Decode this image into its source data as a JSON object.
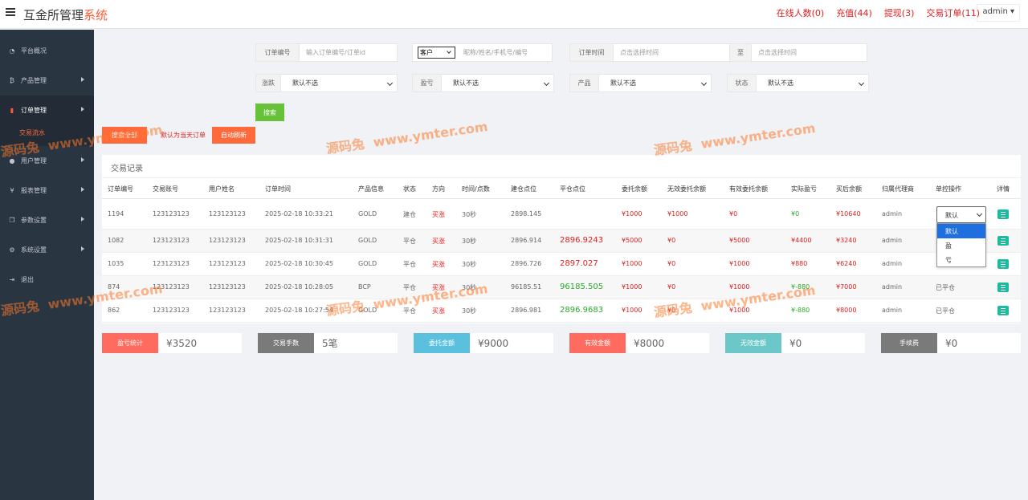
{
  "header": {
    "title_main": "互金所管理",
    "title_accent": "系统",
    "links": [
      "在线人数(0)",
      "充值(44)",
      "提现(3)",
      "交易订单(11)"
    ],
    "admin": "admin"
  },
  "sidebar": {
    "items": [
      {
        "icon": "dashboard-icon",
        "label": "平台概况"
      },
      {
        "icon": "currency-icon",
        "label": "产品管理"
      },
      {
        "icon": "document-icon",
        "label": "订单管理"
      },
      {
        "icon": "user-icon",
        "label": "用户管理"
      },
      {
        "icon": "yen-icon",
        "label": "报表管理"
      },
      {
        "icon": "copy-icon",
        "label": "参数设置"
      },
      {
        "icon": "gears-icon",
        "label": "系统设置"
      },
      {
        "icon": "logout-icon",
        "label": "退出"
      }
    ],
    "sub_item": "交易流水"
  },
  "filters": {
    "order_no_label": "订单编号",
    "order_no_placeholder": "输入订单编号/订单id",
    "customer_select": "客户",
    "customer_placeholder": "昵称/姓名/手机号/编号",
    "time_label": "订单时间",
    "time_start_placeholder": "点击选择时间",
    "to_label": "至",
    "time_end_placeholder": "点击选择时间",
    "updown_label": "涨跌",
    "updown_value": "默认不选",
    "pnl_label": "盈亏",
    "pnl_value": "默认不选",
    "product_label": "产品",
    "product_value": "默认不选",
    "status_label": "状态",
    "status_value": "默认不选",
    "search_button": "搜索",
    "all_button": "搜索全部",
    "default_today": "默认为当天订单",
    "refresh_button": "自动刷新"
  },
  "table": {
    "title": "交易记录",
    "headers": [
      "订单编号",
      "交易账号",
      "用户姓名",
      "订单时间",
      "产品信息",
      "状态",
      "方向",
      "时间/点数",
      "建仓点位",
      "平仓点位",
      "委托余额",
      "无效委托余额",
      "有效委托余额",
      "实际盈亏",
      "买后余额",
      "归属代理商",
      "单控操作",
      "详情"
    ],
    "rows": [
      {
        "id": "1194",
        "account": "123123123",
        "name": "123123123",
        "time": "2025-02-18 10:33:21",
        "product": "GOLD",
        "status": "建仓",
        "direction": "买涨",
        "duration": "30秒",
        "open": "2898.145",
        "close": "",
        "entrust": "¥1000",
        "invalid": "¥1000",
        "valid": "¥0",
        "pnl": "¥0",
        "after": "¥10640",
        "agent": "admin",
        "control": "默认"
      },
      {
        "id": "1082",
        "account": "123123123",
        "name": "123123123",
        "time": "2025-02-18 10:31:31",
        "product": "GOLD",
        "status": "平仓",
        "direction": "买涨",
        "duration": "30秒",
        "open": "2896.914",
        "close": "2896.9243",
        "entrust": "¥5000",
        "invalid": "¥0",
        "valid": "¥5000",
        "pnl": "¥4400",
        "after": "¥3240",
        "agent": "admin",
        "control": ""
      },
      {
        "id": "1035",
        "account": "123123123",
        "name": "123123123",
        "time": "2025-02-18 10:30:45",
        "product": "GOLD",
        "status": "平仓",
        "direction": "买涨",
        "duration": "30秒",
        "open": "2896.726",
        "close": "2897.027",
        "entrust": "¥1000",
        "invalid": "¥0",
        "valid": "¥1000",
        "pnl": "¥880",
        "after": "¥6240",
        "agent": "admin",
        "control": ""
      },
      {
        "id": "874",
        "account": "123123123",
        "name": "123123123",
        "time": "2025-02-18 10:28:05",
        "product": "BCP",
        "status": "平仓",
        "direction": "买涨",
        "duration": "30秒",
        "open": "96185.51",
        "close": "96185.505",
        "entrust": "¥1000",
        "invalid": "¥0",
        "valid": "¥1000",
        "pnl": "¥-880",
        "after": "¥7000",
        "agent": "admin",
        "control": "已平仓"
      },
      {
        "id": "862",
        "account": "123123123",
        "name": "123123123",
        "time": "2025-02-18 10:27:54",
        "product": "GOLD",
        "status": "平仓",
        "direction": "买涨",
        "duration": "30秒",
        "open": "2896.981",
        "close": "2896.9683",
        "entrust": "¥1000",
        "invalid": "¥0",
        "valid": "¥1000",
        "pnl": "¥-880",
        "after": "¥8000",
        "agent": "admin",
        "control": "已平仓"
      }
    ],
    "dropdown_options": [
      "默认",
      "盈",
      "亏"
    ]
  },
  "stats": [
    {
      "label": "盈亏统计",
      "value": "¥3520",
      "color": "#ff6b5e"
    },
    {
      "label": "交易手数",
      "value": "5笔",
      "color": "#7a7a7a"
    },
    {
      "label": "委托金额",
      "value": "¥9000",
      "color": "#5bc0de"
    },
    {
      "label": "有效金额",
      "value": "¥8000",
      "color": "#ff6b5e"
    },
    {
      "label": "无效金额",
      "value": "¥0",
      "color": "#6cc8c8"
    },
    {
      "label": "手续费",
      "value": "¥0",
      "color": "#7a7a7a"
    }
  ],
  "watermark": {
    "brand": "源码兔",
    "url": "www.ymter.com"
  },
  "colors": {
    "accent": "#ff5a36",
    "sidebar": "#2a3542",
    "up_red": "#e02020",
    "down_green": "#2aa82a",
    "search_green": "#67c23a"
  }
}
